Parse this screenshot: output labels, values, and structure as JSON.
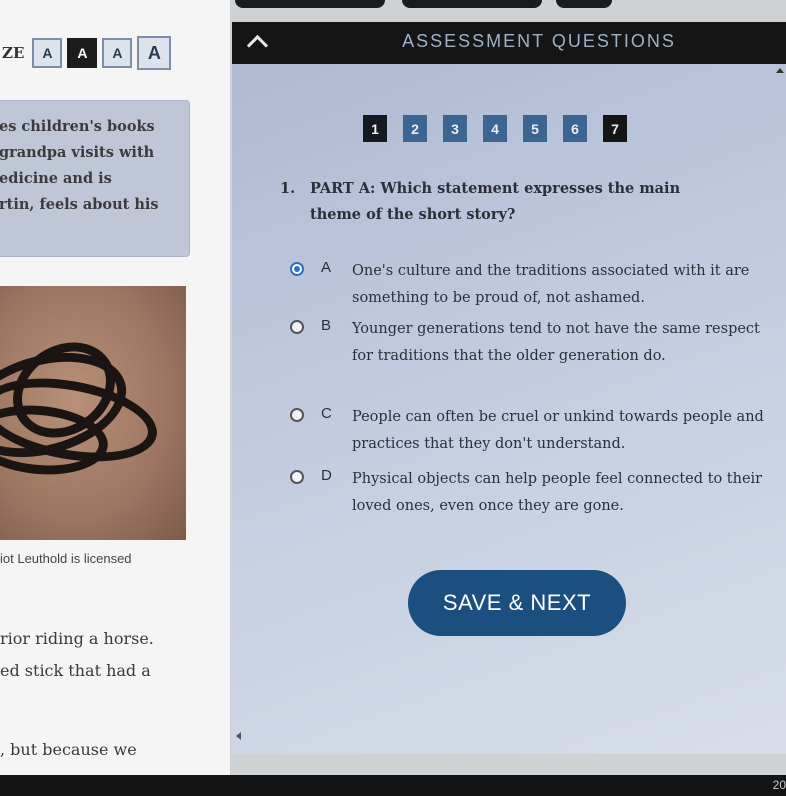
{
  "font_size": {
    "label": "ZE",
    "buttons": [
      "A",
      "A",
      "A",
      "A"
    ]
  },
  "summary_lines": [
    "es children's books",
    "grandpa visits with",
    "edicine and is",
    "rtin, feels about his"
  ],
  "image_caption": "iot Leuthold is licensed",
  "body_lines": [
    "rior riding a horse.",
    "ed stick that had a",
    ", but because we"
  ],
  "panel": {
    "title": "ASSESSMENT QUESTIONS",
    "question_numbers": [
      "1",
      "2",
      "3",
      "4",
      "5",
      "6",
      "7"
    ],
    "current_question": "1"
  },
  "question": {
    "number": "1.",
    "text": "PART A: Which statement expresses the main theme of the short story?",
    "options": [
      {
        "letter": "A",
        "text": "One's culture and the traditions associated with it are something to be proud of, not ashamed.",
        "selected": true
      },
      {
        "letter": "B",
        "text": "Younger generations tend to not have the same respect for traditions that the older generation do.",
        "selected": false
      },
      {
        "letter": "C",
        "text": "People can often be cruel or unkind towards people and practices that they don't understand.",
        "selected": false
      },
      {
        "letter": "D",
        "text": "Physical objects can help people feel connected to their loved ones, even once they are gone.",
        "selected": false
      }
    ]
  },
  "save_button": "SAVE & NEXT",
  "clock": "20",
  "colors": {
    "accent": "#1a4f80",
    "nav_number": "#3d6592",
    "header": "#151515",
    "selected_radio": "#2f6fc0"
  }
}
